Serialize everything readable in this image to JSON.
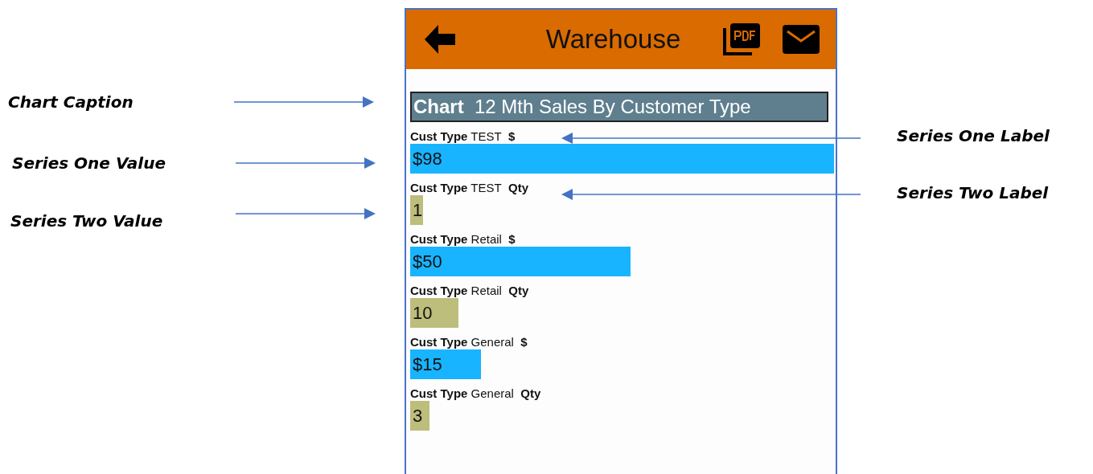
{
  "header": {
    "title": "Warehouse"
  },
  "chart": {
    "caption_label": "Chart",
    "caption": "12 Mth Sales By Customer Type",
    "rows": [
      {
        "prefix": "Cust Type",
        "category": "TEST",
        "series": "$",
        "value": "$98",
        "kind": "amount"
      },
      {
        "prefix": "Cust Type",
        "category": "TEST",
        "series": "Qty",
        "value": "1",
        "kind": "qty"
      },
      {
        "prefix": "Cust Type",
        "category": "Retail",
        "series": "$",
        "value": "$50",
        "kind": "amount"
      },
      {
        "prefix": "Cust Type",
        "category": "Retail",
        "series": "Qty",
        "value": "10",
        "kind": "qty"
      },
      {
        "prefix": "Cust Type",
        "category": "General",
        "series": "$",
        "value": "$15",
        "kind": "amount"
      },
      {
        "prefix": "Cust Type",
        "category": "General",
        "series": "Qty",
        "value": "3",
        "kind": "qty"
      }
    ]
  },
  "annotations": [
    {
      "text": "Chart Caption",
      "kind": "left"
    },
    {
      "text": "Series One Label",
      "kind": "right"
    },
    {
      "text": "Series One Value",
      "kind": "left"
    },
    {
      "text": "Series Two Label",
      "kind": "right"
    },
    {
      "text": "Series Two Value",
      "kind": "left"
    }
  ]
}
